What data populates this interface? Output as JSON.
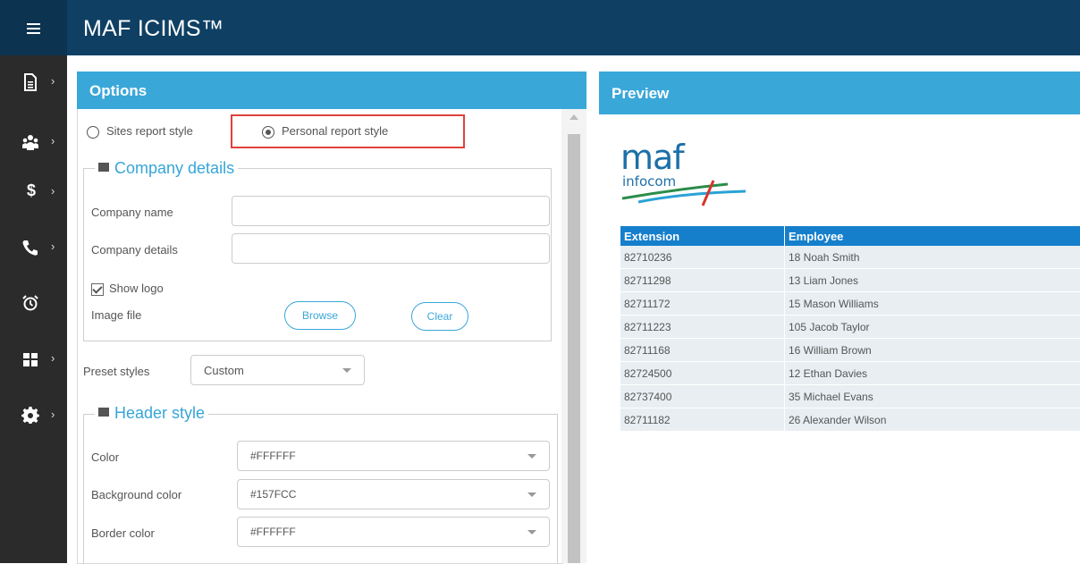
{
  "app": {
    "title": "MAF ICIMS™"
  },
  "nav": {
    "items": [
      {
        "icon": "report-icon",
        "has_submenu": true
      },
      {
        "icon": "users-icon",
        "has_submenu": true
      },
      {
        "icon": "dollar-icon",
        "has_submenu": true
      },
      {
        "icon": "phone-icon",
        "has_submenu": true
      },
      {
        "icon": "alarm-clock-icon",
        "has_submenu": false
      },
      {
        "icon": "widgets-icon",
        "has_submenu": true
      },
      {
        "icon": "gear-icon",
        "has_submenu": true
      }
    ],
    "chevron": "›",
    "dollar_glyph": "$"
  },
  "options": {
    "title": "Options",
    "report_style": {
      "sites_label": "Sites report style",
      "personal_label": "Personal report style",
      "selected": "personal"
    },
    "company_details": {
      "legend": "Company details",
      "company_name_label": "Company name",
      "company_name_value": "",
      "company_details_label": "Company details",
      "company_details_value": "",
      "show_logo_label": "Show logo",
      "show_logo_checked": true,
      "image_file_label": "Image file",
      "browse_label": "Browse",
      "clear_label": "Clear"
    },
    "preset_styles": {
      "label": "Preset styles",
      "value": "Custom"
    },
    "header_style": {
      "legend": "Header style",
      "color_label": "Color",
      "color_value": "#FFFFFF",
      "bg_label": "Background color",
      "bg_value": "#157FCC",
      "border_label": "Border color",
      "border_value": "#FFFFFF"
    }
  },
  "preview": {
    "title": "Preview",
    "logo": {
      "line1": "maf",
      "line2": "infocom"
    },
    "table": {
      "columns": [
        "Extension",
        "Employee"
      ],
      "rows": [
        [
          "82710236",
          "18 Noah Smith"
        ],
        [
          "82711298",
          "13 Liam Jones"
        ],
        [
          "82711172",
          "15 Mason Williams"
        ],
        [
          "82711223",
          "105 Jacob Taylor"
        ],
        [
          "82711168",
          "16 William Brown"
        ],
        [
          "82724500",
          "12 Ethan Davies"
        ],
        [
          "82737400",
          "35 Michael Evans"
        ],
        [
          "82711182",
          "26 Alexander Wilson"
        ]
      ]
    }
  },
  "colors": {
    "topbar": "#0f4064",
    "panel_header": "#3aa7d9",
    "table_header": "#157fcc",
    "highlight": "#e0413b"
  }
}
